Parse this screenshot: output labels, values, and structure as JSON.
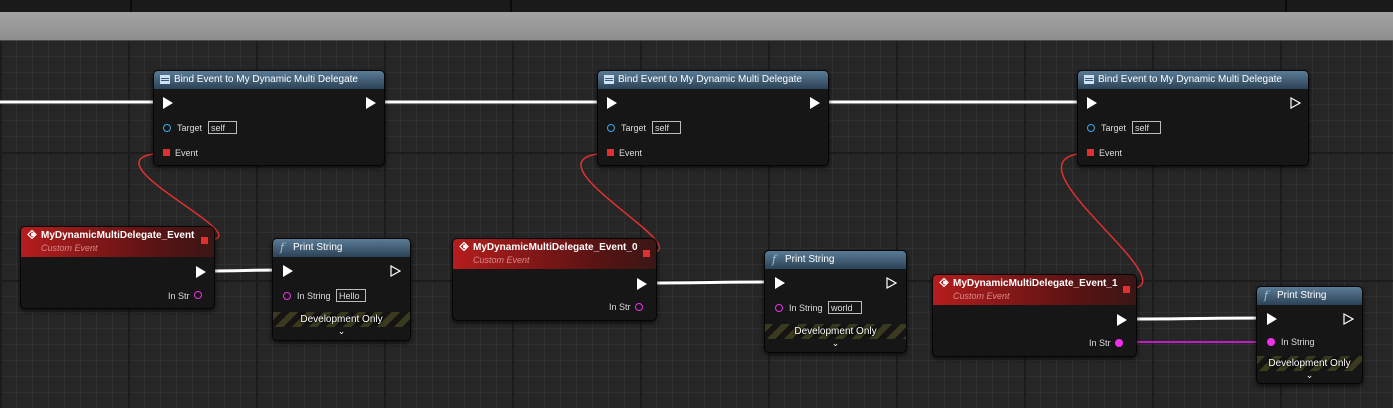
{
  "bind_nodes": [
    {
      "title": "Bind Event to My Dynamic Multi Delegate",
      "target_label": "Target",
      "target_value": "self",
      "event_label": "Event"
    },
    {
      "title": "Bind Event to My Dynamic Multi Delegate",
      "target_label": "Target",
      "target_value": "self",
      "event_label": "Event"
    },
    {
      "title": "Bind Event to My Dynamic Multi Delegate",
      "target_label": "Target",
      "target_value": "self",
      "event_label": "Event"
    }
  ],
  "event_nodes": [
    {
      "title": "MyDynamicMultiDelegate_Event",
      "subtitle": "Custom Event",
      "pin_label": "In Str"
    },
    {
      "title": "MyDynamicMultiDelegate_Event_0",
      "subtitle": "Custom Event",
      "pin_label": "In Str"
    },
    {
      "title": "MyDynamicMultiDelegate_Event_1",
      "subtitle": "Custom Event",
      "pin_label": "In Str"
    }
  ],
  "print_nodes": [
    {
      "title": "Print String",
      "pin_label": "In String",
      "value": "Hello",
      "footer": "Development Only"
    },
    {
      "title": "Print String",
      "pin_label": "In String",
      "value": "world",
      "footer": "Development Only"
    },
    {
      "title": "Print String",
      "pin_label": "In String",
      "value": "",
      "footer": "Development Only"
    }
  ],
  "icons": {
    "function": "f",
    "expand": "⌄"
  },
  "colors": {
    "exec": "#ffffff",
    "delegate": "#e03030",
    "string": "#f030e8",
    "object": "#3aa8e8",
    "event_header": "#b51d1d",
    "function_header": "#5a7b96",
    "grid": "#262626"
  }
}
